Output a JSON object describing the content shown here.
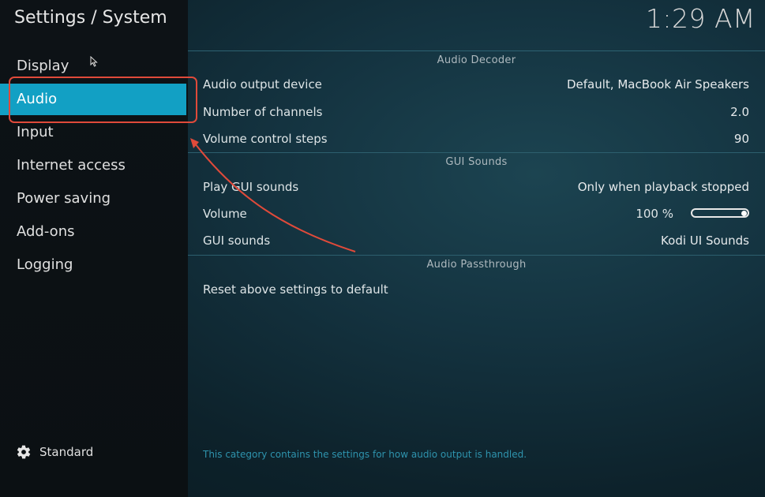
{
  "header": {
    "title": "Settings / System",
    "clock": "1:29 AM"
  },
  "sidebar": {
    "items": [
      {
        "label": "Display"
      },
      {
        "label": "Audio",
        "active": true
      },
      {
        "label": "Input"
      },
      {
        "label": "Internet access"
      },
      {
        "label": "Power saving"
      },
      {
        "label": "Add-ons"
      },
      {
        "label": "Logging"
      }
    ],
    "level": {
      "icon": "gear-icon",
      "label": "Standard"
    }
  },
  "sections": {
    "audio_decoder": {
      "header": "Audio Decoder",
      "rows": [
        {
          "label": "Audio output device",
          "value": "Default, MacBook Air Speakers"
        },
        {
          "label": "Number of channels",
          "value": "2.0"
        },
        {
          "label": "Volume control steps",
          "value": "90"
        }
      ]
    },
    "gui_sounds": {
      "header": "GUI Sounds",
      "play_row": {
        "label": "Play GUI sounds",
        "value": "Only when playback stopped"
      },
      "volume_row": {
        "label": "Volume",
        "value": "100 %",
        "slider_level": 1.0
      },
      "sounds_row": {
        "label": "GUI sounds",
        "value": "Kodi UI Sounds"
      }
    },
    "audio_passthrough": {
      "header": "Audio Passthrough"
    },
    "reset": {
      "label": "Reset above settings to default"
    }
  },
  "help_text": "This category contains the settings for how audio output is handled.",
  "colors": {
    "active_item": "#12a0c4",
    "annotation": "#e04a3a",
    "help_text": "#2e93ad"
  }
}
